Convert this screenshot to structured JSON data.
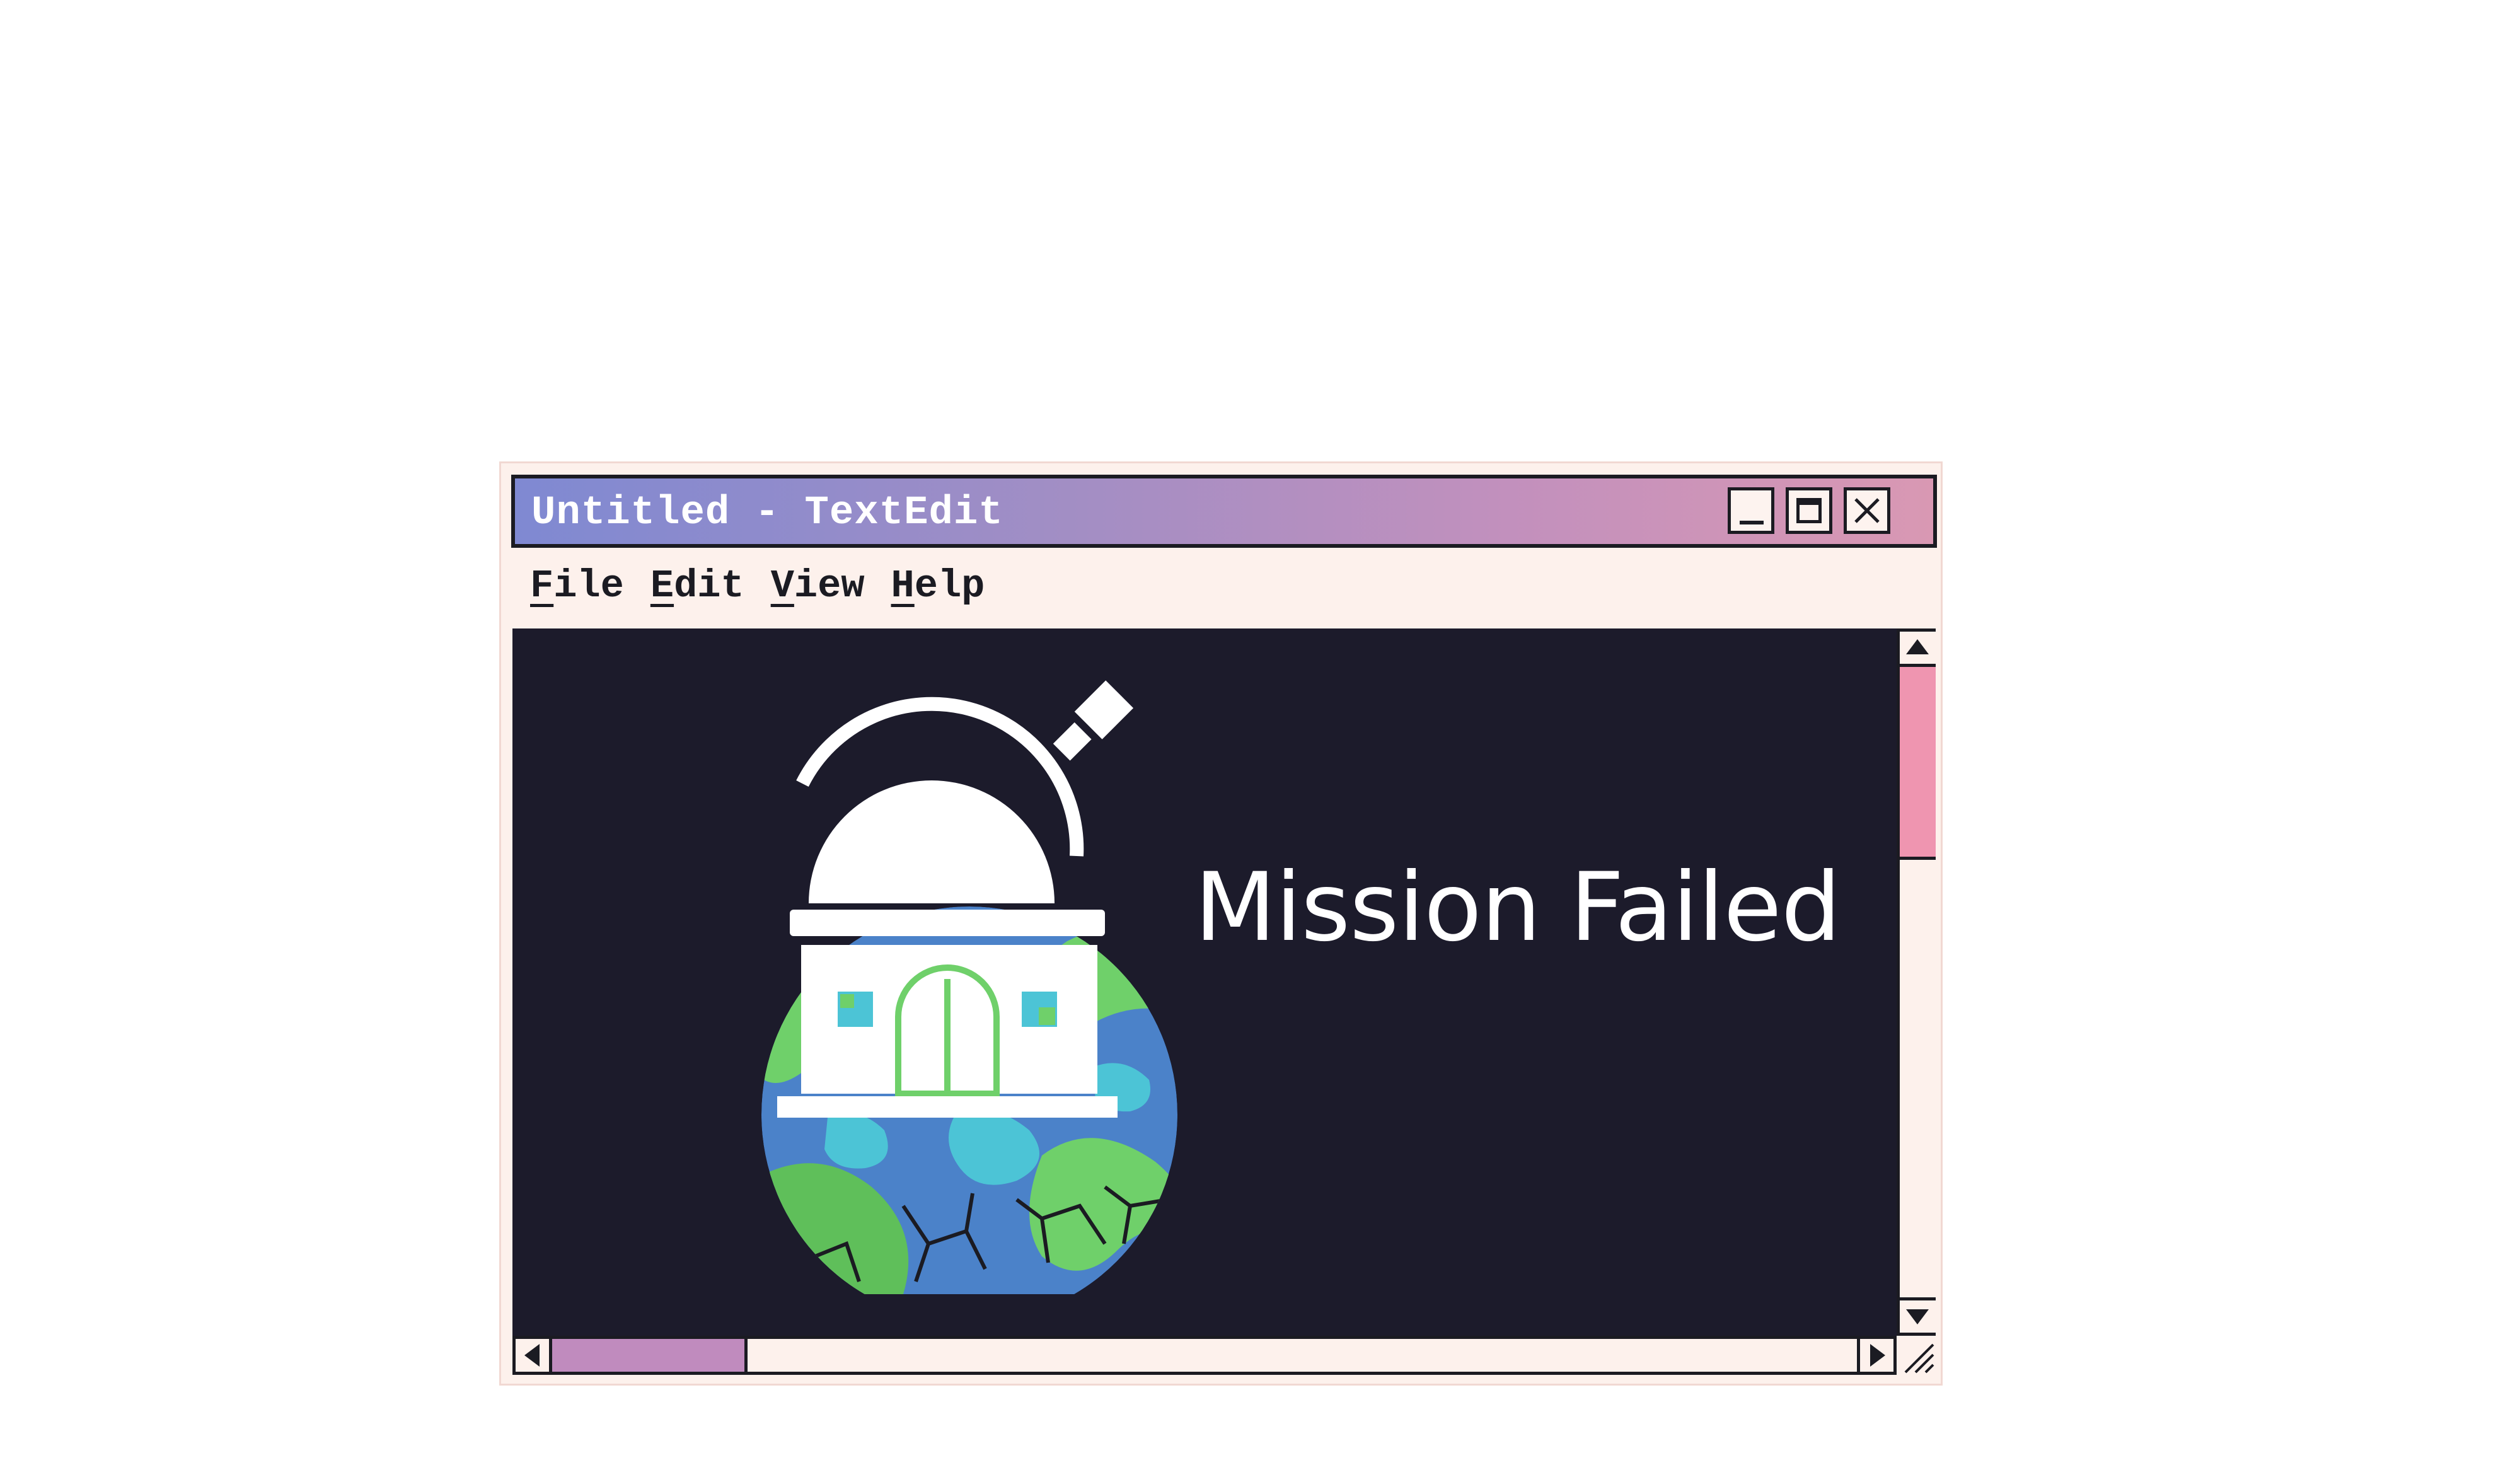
{
  "window": {
    "title": "Untitled - TextEdit",
    "buttons": {
      "minimize": "minimize",
      "maximize": "maximize",
      "close": "close"
    }
  },
  "menu": {
    "items": [
      {
        "mnemonic": "F",
        "rest": "ile"
      },
      {
        "mnemonic": "E",
        "rest": "dit"
      },
      {
        "mnemonic": "V",
        "rest": "iew"
      },
      {
        "mnemonic": "H",
        "rest": "elp"
      }
    ]
  },
  "content": {
    "headline": "Mission Failed",
    "background_color": "#1c1b2b",
    "logo_icon": "observatory-on-cracked-earth-icon"
  },
  "scrollbars": {
    "vertical_thumb_color": "#ef95b0",
    "horizontal_thumb_color": "#c08bbe"
  },
  "colors": {
    "titlebar_gradient_start": "#7f89d2",
    "titlebar_gradient_end": "#d998b3",
    "window_bg": "#fdf1ec",
    "border": "#1b1b22"
  }
}
